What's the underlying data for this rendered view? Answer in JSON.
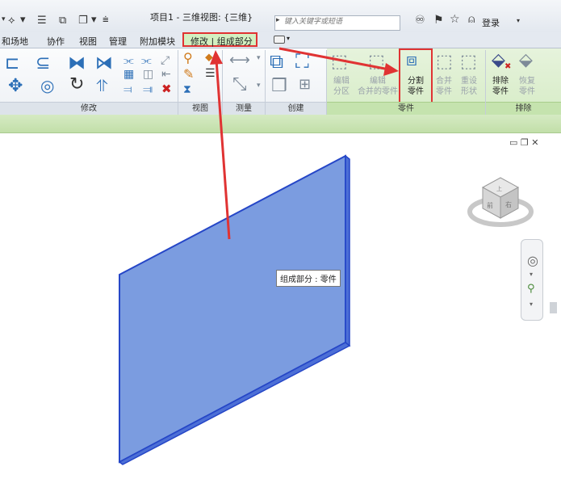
{
  "window": {
    "title": "项目1 - 三维视图: {三维}",
    "search_placeholder": "键入关键字或短语",
    "login_label": "登录"
  },
  "tabs": [
    {
      "label": "和场地"
    },
    {
      "label": "协作"
    },
    {
      "label": "视图"
    },
    {
      "label": "管理"
    },
    {
      "label": "附加模块"
    }
  ],
  "context_tab": {
    "label": "修改 | 组成部分",
    "highlight_color": "#e03333",
    "bg_color": "#d3f0c1"
  },
  "ribbon": {
    "panels": [
      {
        "title": "修改"
      },
      {
        "title": "视图"
      },
      {
        "title": "测量"
      },
      {
        "title": "创建"
      },
      {
        "title": "零件"
      },
      {
        "title": "排除"
      }
    ],
    "parts_buttons": [
      {
        "line1": "编辑",
        "line2": "分区",
        "enabled": false
      },
      {
        "line1": "编辑",
        "line2": "合并的零件",
        "enabled": false
      },
      {
        "line1": "分割",
        "line2": "零件",
        "enabled": true
      },
      {
        "line1": "合并",
        "line2": "零件",
        "enabled": false
      },
      {
        "line1": "重设",
        "line2": "形状",
        "enabled": false
      }
    ],
    "exclude_buttons": [
      {
        "line1": "排除",
        "line2": "零件",
        "enabled": true
      },
      {
        "line1": "恢复",
        "line2": "零件",
        "enabled": false
      }
    ]
  },
  "viewport": {
    "tooltip": "组成部分 : 零件",
    "wall_color": "#7b9ce0",
    "wall_edge_color": "#2546c7",
    "viewcube": {
      "face_front": "前",
      "face_right": "右",
      "face_top": "上"
    }
  },
  "annotation": {
    "color": "#e03333"
  }
}
